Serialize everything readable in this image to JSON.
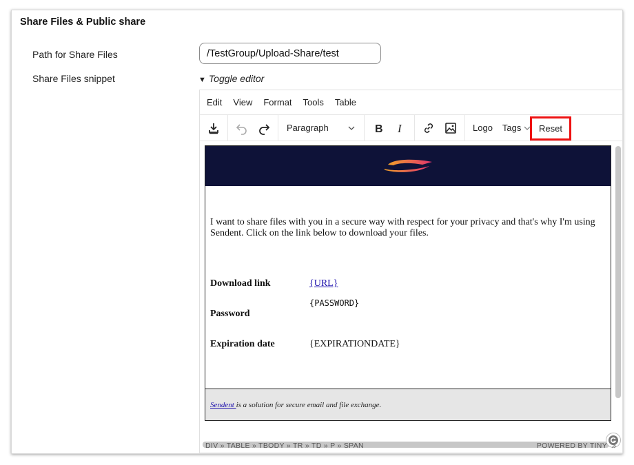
{
  "section": {
    "title": "Share Files & Public share"
  },
  "labels": {
    "path": "Path for Share Files",
    "snippet": "Share Files snippet"
  },
  "path_input": {
    "value": "/TestGroup/Upload-Share/test"
  },
  "toggle": {
    "label": "Toggle editor"
  },
  "menubar": {
    "items": [
      "Edit",
      "View",
      "Format",
      "Tools",
      "Table"
    ]
  },
  "toolbar": {
    "block_format": "Paragraph",
    "logo_label": "Logo",
    "tags_label": "Tags",
    "reset_label": "Reset"
  },
  "content": {
    "intro": "I want to share files with you in a secure way with respect for your privacy and that's why I'm using Sendent. Click on the link below to download your files.",
    "rows": [
      {
        "label": "Download link",
        "value": "{URL}"
      },
      {
        "label": "Password",
        "value": "{PASSWORD}"
      },
      {
        "label": "Expiration date",
        "value": "{EXPIRATIONDATE}"
      }
    ],
    "footer_link": "Sendent ",
    "footer_text": "is a solution for secure email and file exchange."
  },
  "statusbar": {
    "path": "DIV » TABLE » TBODY » TR » TD » P » SPAN",
    "powered": "POWERED BY TINY"
  },
  "colors": {
    "banner": "#0e1238",
    "highlight": "#ee1111",
    "link": "#1a0dab"
  },
  "icons": [
    "save-icon",
    "undo-icon",
    "redo-icon",
    "bold-icon",
    "italic-icon",
    "link-icon",
    "image-icon",
    "chevron-down-icon",
    "logo-icon",
    "grammarly-icon",
    "resize-handle-icon"
  ]
}
